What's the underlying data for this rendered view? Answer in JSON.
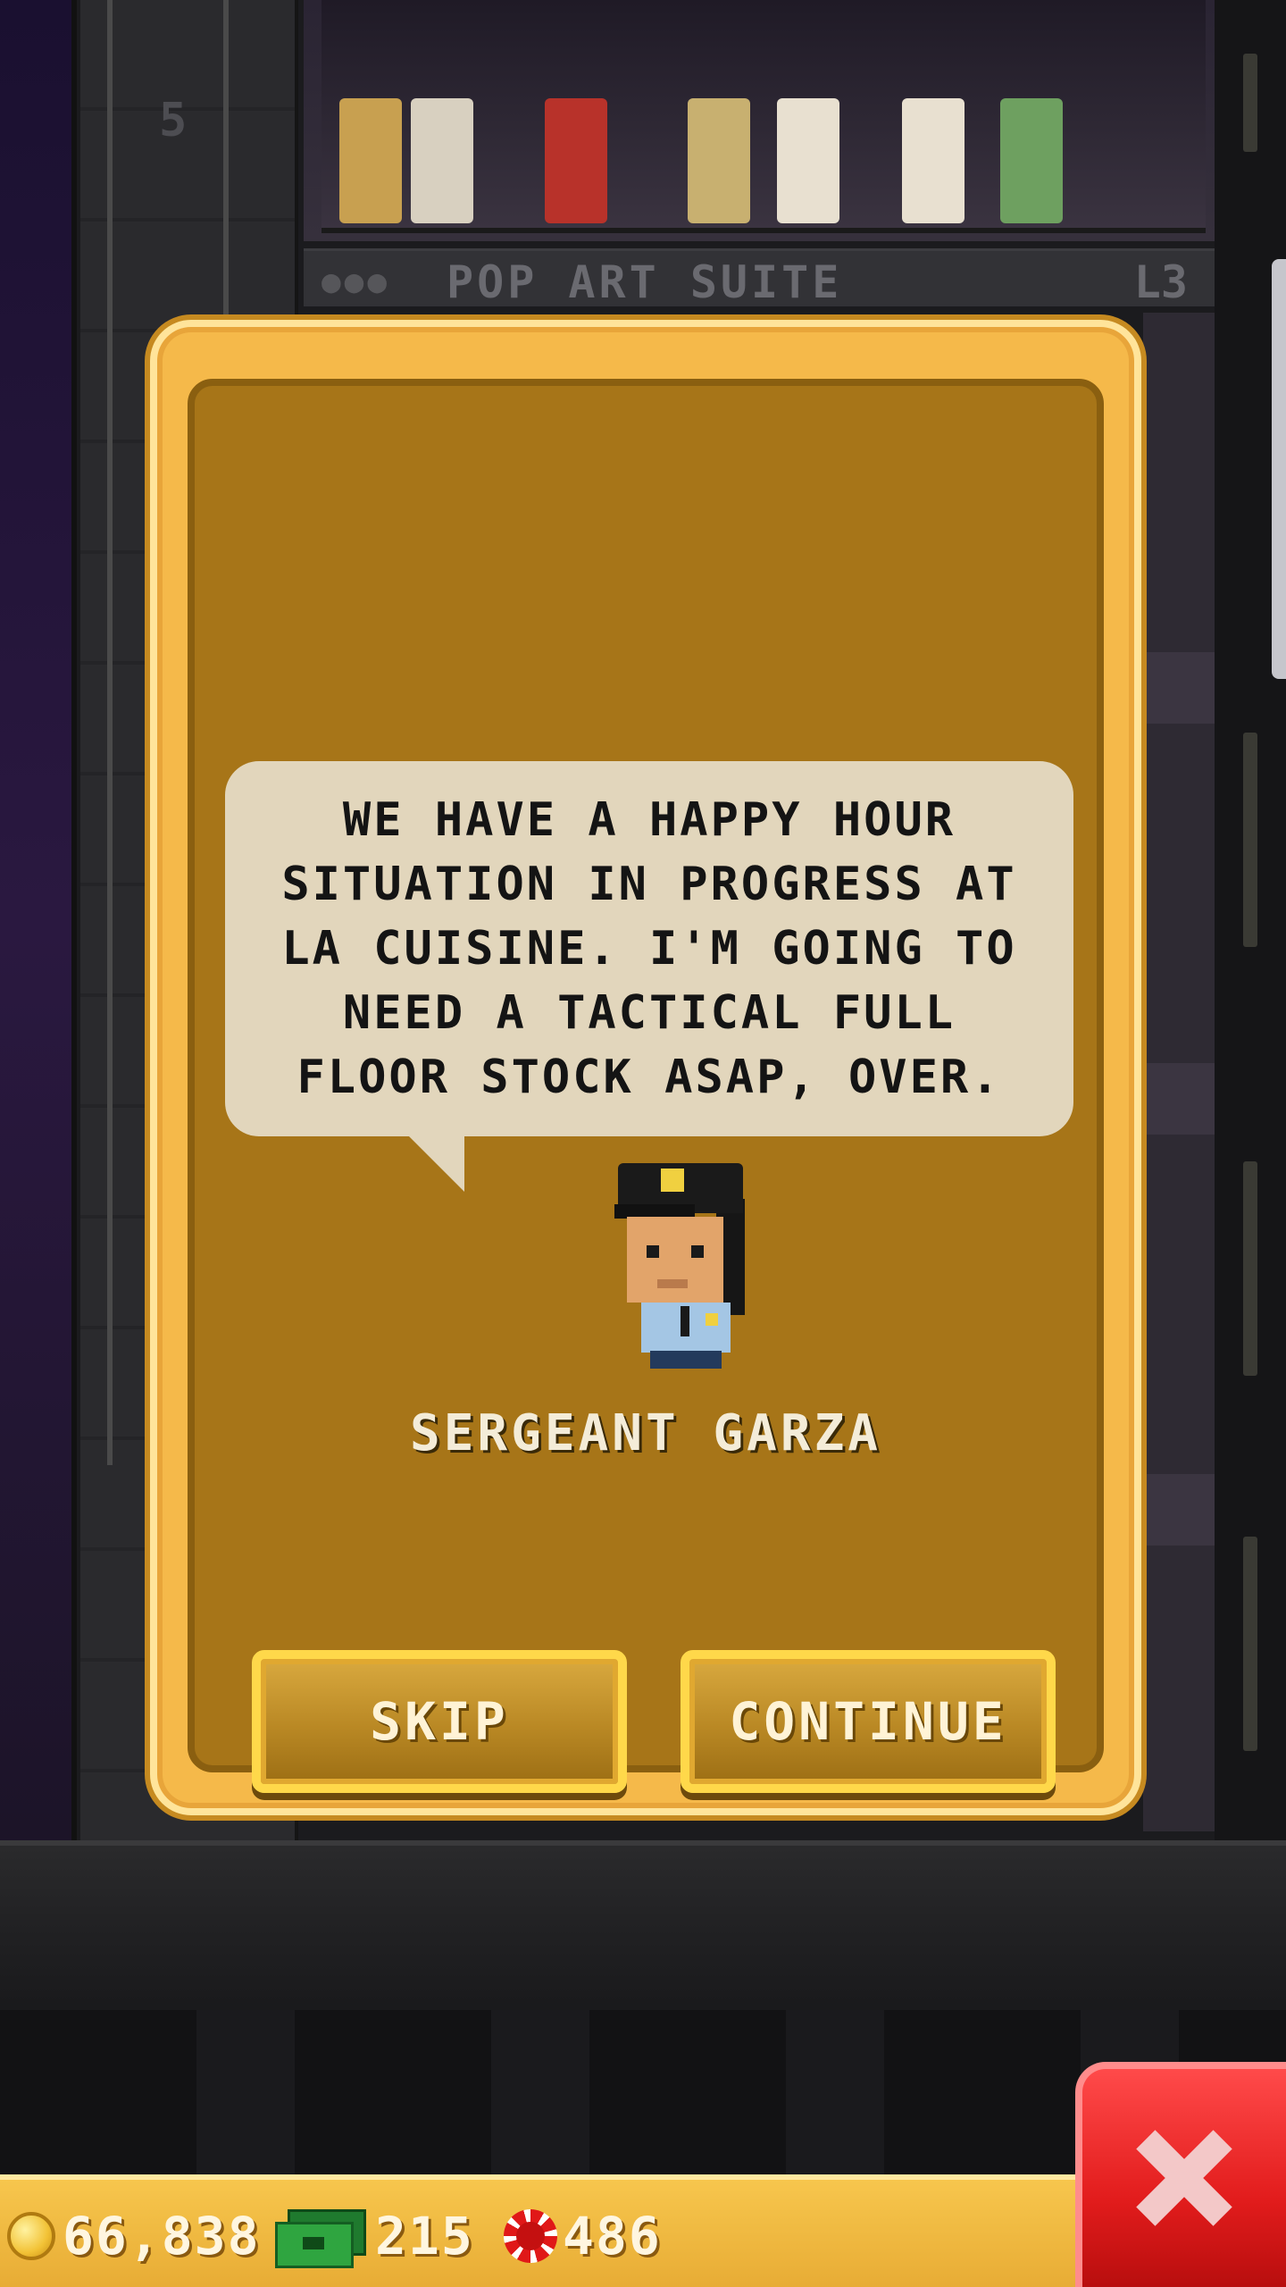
{
  "background": {
    "floor_number": "5",
    "floor_name": "POP ART SUITE",
    "floor_level": "L3"
  },
  "dialog": {
    "message": "WE HAVE A HAPPY HOUR SITUATION IN PROGRESS AT LA CUISINE. I'M GOING TO NEED A TACTICAL FULL FLOOR STOCK ASAP, OVER.",
    "speaker_name": "SERGEANT GARZA",
    "speaker_icon": "police-officer-sprite",
    "skip_label": "SKIP",
    "continue_label": "CONTINUE"
  },
  "hud": {
    "coins": "66,838",
    "bux": "215",
    "chips": "486",
    "coin_icon": "gold-coin-icon",
    "bux_icon": "green-cash-icon",
    "chip_icon": "red-chip-icon"
  },
  "close_icon": "close-x-icon",
  "colors": {
    "dialog_border": "#f5b94a",
    "dialog_fill": "#a77518",
    "bubble": "#e2d6bc",
    "hud": "#f7c64d",
    "close": "#e21c1c"
  }
}
